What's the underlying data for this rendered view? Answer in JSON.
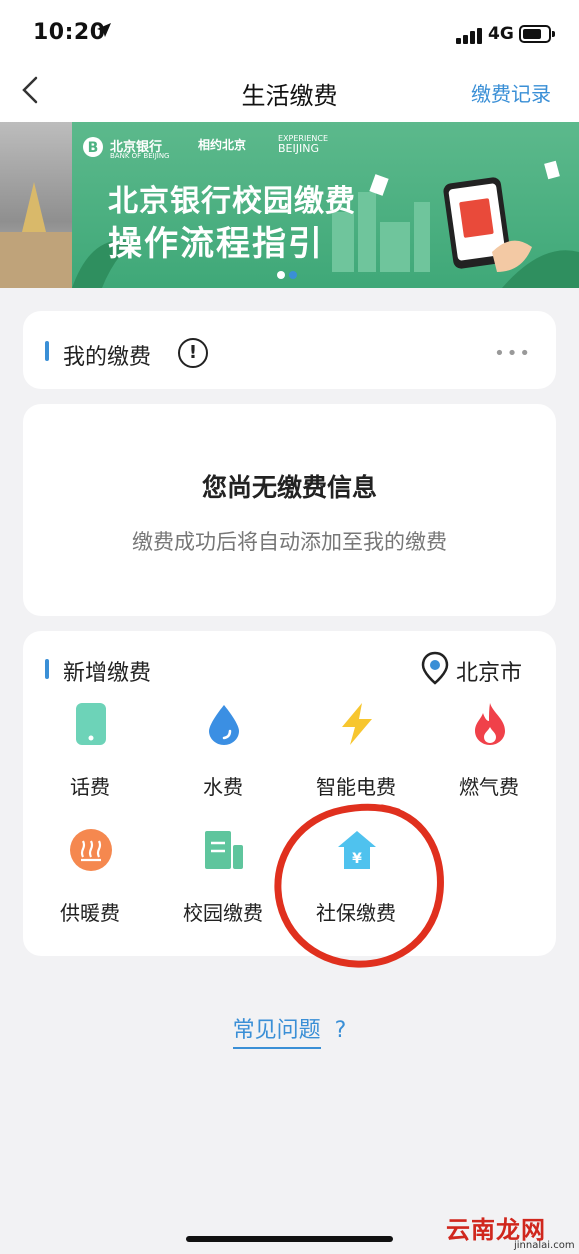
{
  "status_bar": {
    "time": "10:20",
    "network": "4G"
  },
  "nav": {
    "title": "生活缴费",
    "records_label": "缴费记录"
  },
  "banner": {
    "bank_name": "北京银行",
    "bank_name_en": "BANK OF BEIJING",
    "experience_cn": "相约北京",
    "experience_en_1": "EXPERIENCE",
    "experience_en_2": "BEIJING",
    "line1": "北京银行校园缴费",
    "line2": "操作流程指引",
    "active_slide": 2,
    "slide_count": 2
  },
  "my_payments": {
    "title": "我的缴费",
    "info_glyph": "!",
    "more_glyph": "•••",
    "empty_title": "您尚无缴费信息",
    "empty_desc": "缴费成功后将自动添加至我的缴费"
  },
  "new_payments": {
    "title": "新增缴费",
    "location": "北京市",
    "items": [
      {
        "label": "话费",
        "icon": "phone-icon"
      },
      {
        "label": "水费",
        "icon": "water-drop-icon"
      },
      {
        "label": "智能电费",
        "icon": "lightning-icon"
      },
      {
        "label": "燃气费",
        "icon": "flame-icon"
      },
      {
        "label": "供暖费",
        "icon": "heating-icon"
      },
      {
        "label": "校园缴费",
        "icon": "campus-icon"
      },
      {
        "label": "社保缴费",
        "icon": "social-security-icon"
      }
    ]
  },
  "faq": {
    "label": "常见问题",
    "glyph": "?"
  },
  "watermark": {
    "text": "云南龙网",
    "url": "jinnalai.com"
  },
  "colors": {
    "accent": "#3a8fd6",
    "banner_green": "#4db282",
    "annotation_red": "#e0301e"
  }
}
